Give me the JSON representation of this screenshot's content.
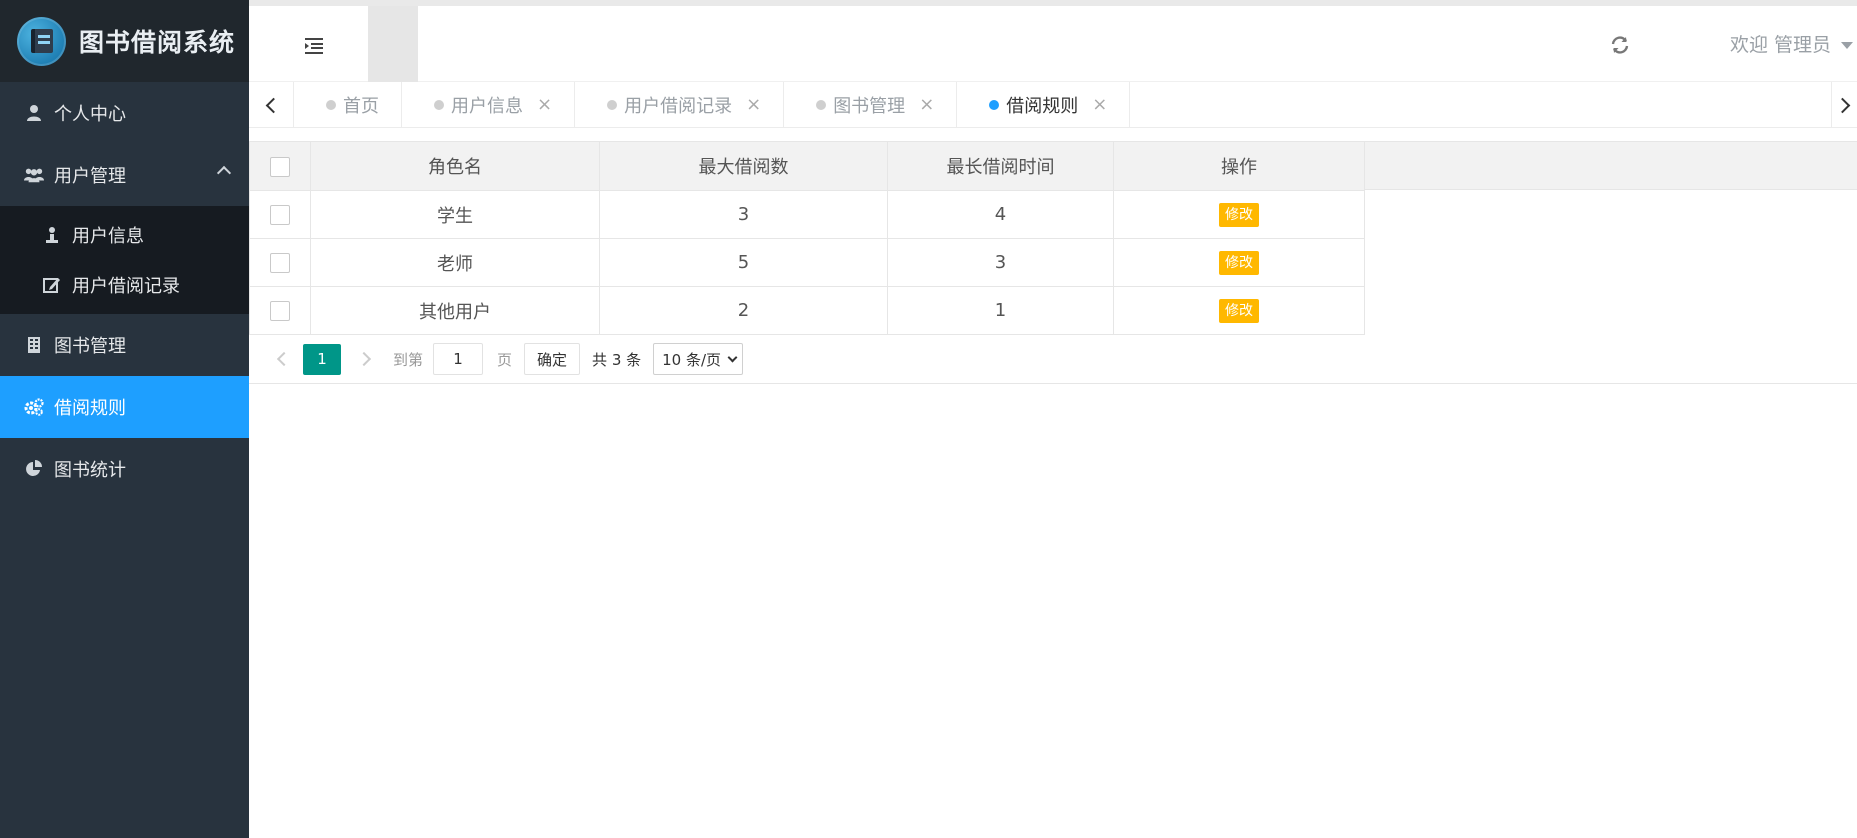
{
  "app": {
    "title": "图书借阅系统"
  },
  "sidebar": {
    "items": [
      {
        "label": "个人中心",
        "icon": "user-icon"
      },
      {
        "label": "用户管理",
        "icon": "users-icon",
        "expanded": true
      },
      {
        "label": "用户信息",
        "icon": "user-info-icon",
        "sub": true
      },
      {
        "label": "用户借阅记录",
        "icon": "edit-icon",
        "sub": true
      },
      {
        "label": "图书管理",
        "icon": "building-icon"
      },
      {
        "label": "借阅规则",
        "icon": "gears-icon",
        "active": true
      },
      {
        "label": "图书统计",
        "icon": "pie-chart-icon"
      }
    ]
  },
  "header": {
    "welcome": "欢迎 管理员"
  },
  "tabs": [
    {
      "label": "首页",
      "closable": false
    },
    {
      "label": "用户信息",
      "closable": true
    },
    {
      "label": "用户借阅记录",
      "closable": true
    },
    {
      "label": "图书管理",
      "closable": true
    },
    {
      "label": "借阅规则",
      "closable": true,
      "active": true
    }
  ],
  "tab_close_glyph": "×",
  "table": {
    "columns": [
      "角色名",
      "最大借阅数",
      "最长借阅时间",
      "操作"
    ],
    "rows": [
      {
        "role": "学生",
        "max_borrow": "3",
        "max_days": "4",
        "action": "修改"
      },
      {
        "role": "老师",
        "max_borrow": "5",
        "max_days": "3",
        "action": "修改"
      },
      {
        "role": "其他用户",
        "max_borrow": "2",
        "max_days": "1",
        "action": "修改"
      }
    ]
  },
  "pager": {
    "current_page": "1",
    "goto_label": "到第",
    "goto_value": "1",
    "page_unit": "页",
    "confirm_label": "确定",
    "total_label": "共 3 条",
    "page_size": "10 条/页"
  },
  "colors": {
    "sidebar_bg": "#28333e",
    "logo_bg": "#20272d",
    "active": "#1e9fff",
    "edit_button": "#ffb800",
    "pager_current": "#009688"
  }
}
